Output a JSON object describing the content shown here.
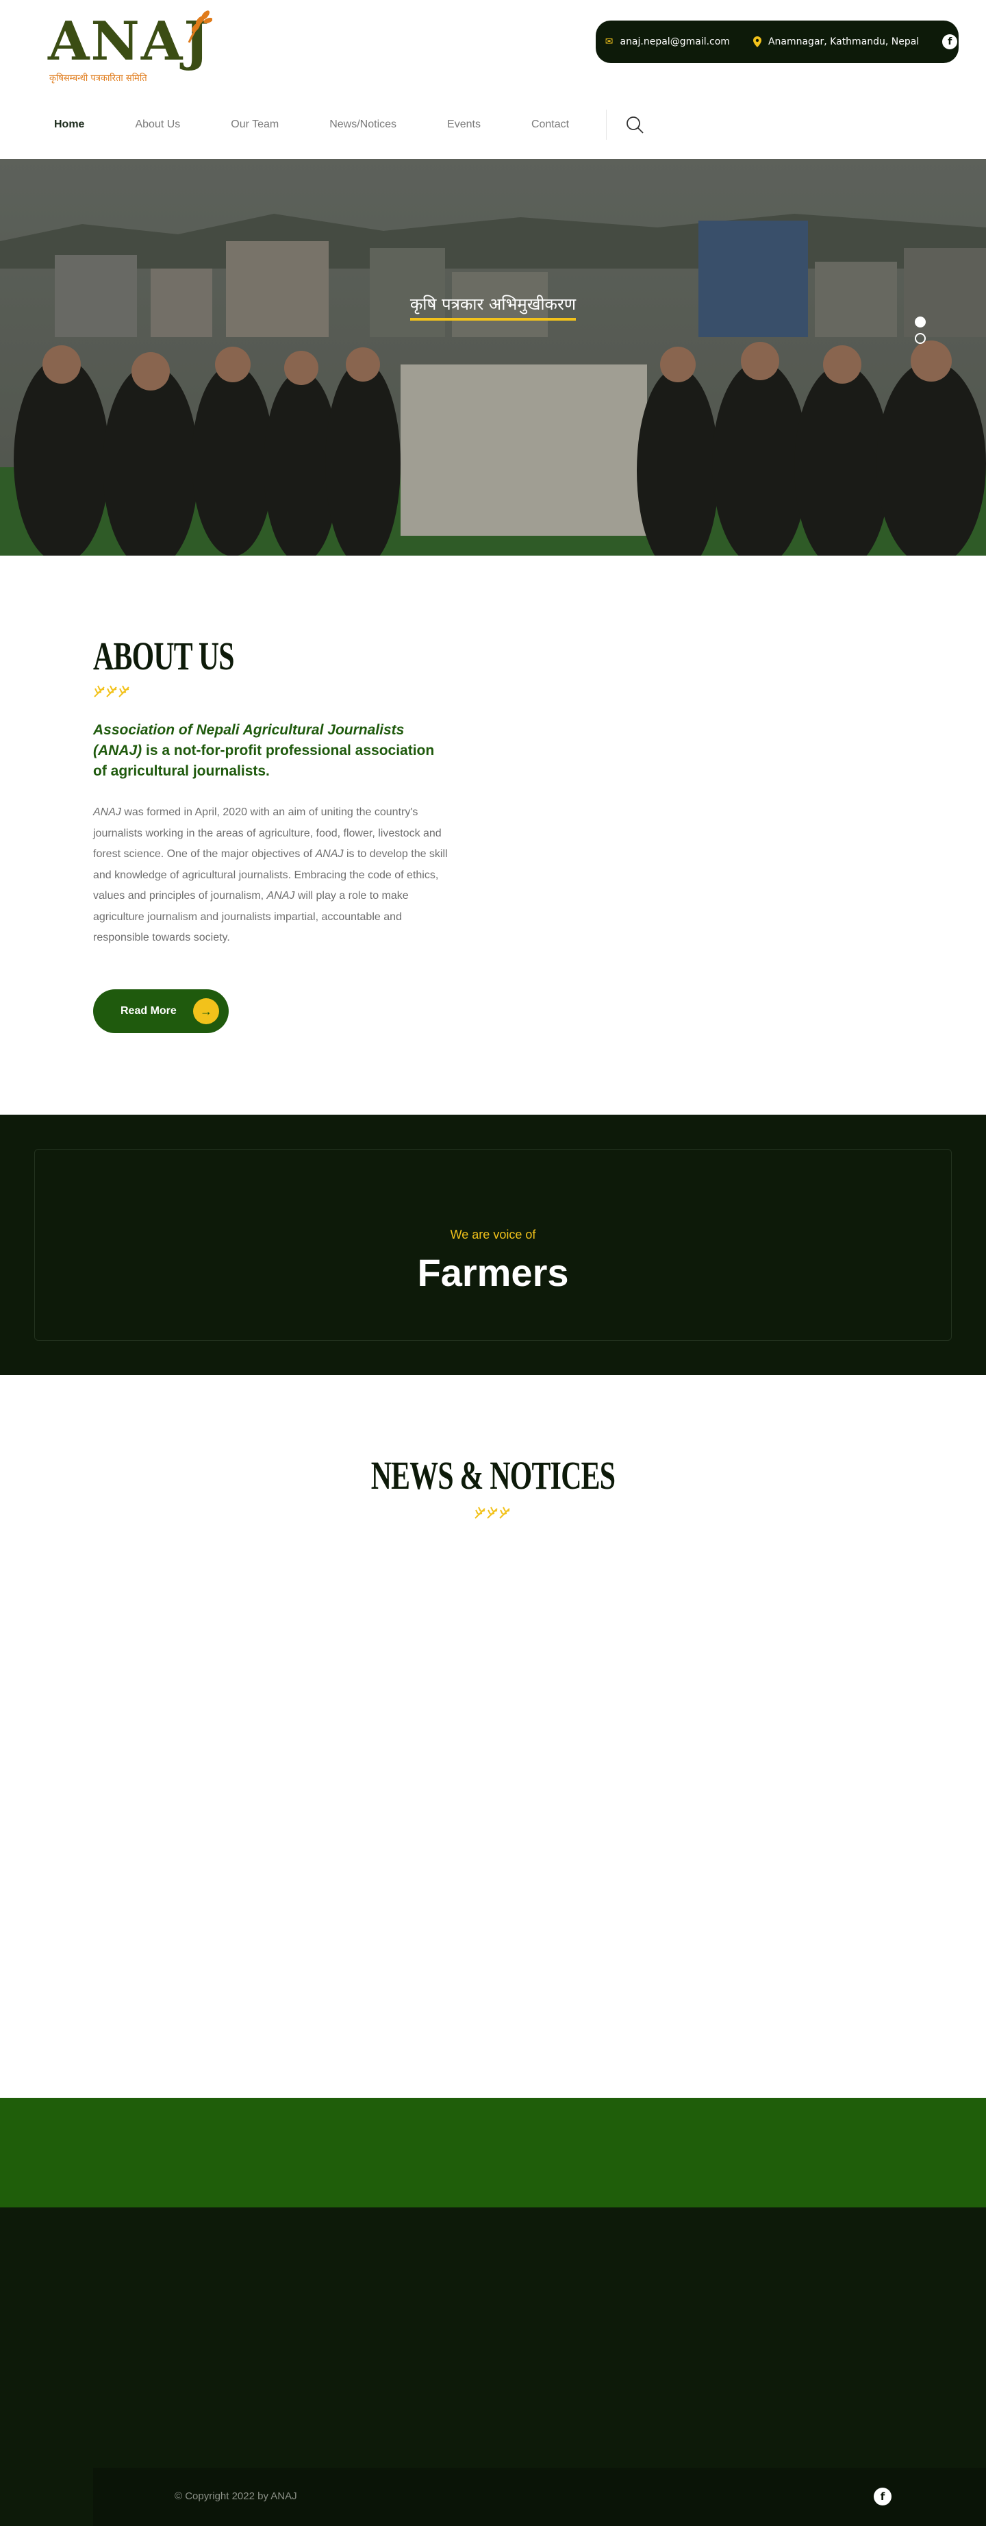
{
  "brand": {
    "logo_text": "ANAJ",
    "logo_tagline": "कृषिसम्बन्धी पत्रकारिता समिति"
  },
  "contact": {
    "email": "anaj.nepal@gmail.com",
    "address": "Anamnagar, Kathmandu, Nepal",
    "email_icon": "mail-icon",
    "address_icon": "map-pin-icon",
    "social_icon": "facebook-icon"
  },
  "nav": {
    "items": [
      {
        "label": "Home",
        "active": true
      },
      {
        "label": "About Us",
        "active": false
      },
      {
        "label": "Our Team",
        "active": false
      },
      {
        "label": "News/Notices",
        "active": false
      },
      {
        "label": "Events",
        "active": false
      },
      {
        "label": "Contact",
        "active": false
      }
    ],
    "search_icon": "search-icon"
  },
  "hero": {
    "caption": "कृषि पत्रकार अभिमुखीकरण",
    "slides": 2,
    "active_slide": 1
  },
  "about": {
    "title": "ABOUT US",
    "lead_org": "Association of Nepali Agricultural Journalists (ANAJ)",
    "lead_rest": " is a not-for-profit professional association of agricultural journalists.",
    "body_1_abbr": "ANAJ",
    "body_1": " was formed in April, 2020 with an aim of uniting the country's journalists working in the areas of agriculture, food, flower, livestock and forest science. One of the major objectives of ",
    "body_2_abbr": "ANAJ",
    "body_2": " is to develop the skill and knowledge of agricultural journalists. Embracing the code of ethics, values and principles of journalism, ",
    "body_3_abbr": "ANAJ",
    "body_3": " will play a role to make agriculture journalism and journalists impartial, accountable and responsible towards society.",
    "button_label": "Read More",
    "button_icon": "arrow-right-icon"
  },
  "voice": {
    "kicker": "We are voice of",
    "title": "Farmers"
  },
  "news": {
    "title": "NEWS & NOTICES"
  },
  "footer": {
    "copyright": "© Copyright 2022 by ANAJ",
    "social_icon": "facebook-icon"
  },
  "colors": {
    "brand_green": "#1f5a0d",
    "dark_green": "#0d1a09",
    "accent_yellow": "#f2c21b",
    "logo_olive": "#3b4d14",
    "logo_orange": "#e07b1a"
  }
}
